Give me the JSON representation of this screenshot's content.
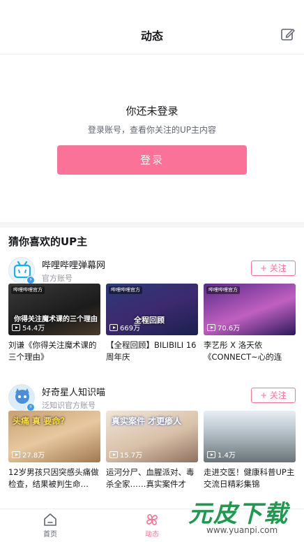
{
  "header": {
    "title": "动态",
    "edit_icon": "edit-icon"
  },
  "login": {
    "title": "你还未登录",
    "subtitle": "登录账号，查看你关注的UP主内容",
    "button_label": "登录"
  },
  "recommend": {
    "section_title": "猜你喜欢的UP主",
    "follow_label": "+ 关注",
    "ups": [
      {
        "name": "哔哩哔哩弹幕网",
        "desc": "官方账号",
        "videos": [
          {
            "views": "54.4万",
            "title": "刘谦《你得关注魔术课的三个理由》",
            "overlay": "你得关注魔术课的三个理由",
            "badge": "哔哩哔哩官方"
          },
          {
            "views": "669万",
            "title": "【全程回顾】BILIBILI 16周年庆",
            "overlay": "全程回顾",
            "badge": "哔哩哔哩官方"
          },
          {
            "views": "70.6万",
            "title": "李艺彤 X 洛天依《CONNECT~心的连接…",
            "overlay": "",
            "badge": "哔哩哔哩官方"
          }
        ]
      },
      {
        "name": "好奇星人知识喵",
        "desc": "泛知识官方账号",
        "videos": [
          {
            "views": "27.8万",
            "title": "12岁男孩只因突感头痛做检查，结果被判生命…",
            "overlay": "头痛 真 要命？",
            "badge": ""
          },
          {
            "views": "15.7万",
            "title": "运河分尸、血腥派对、毒杀全家……真实案件才更…",
            "overlay": "真实案件 才更瘆人",
            "badge": ""
          },
          {
            "views": "1.4万",
            "title": "走进交医！健康科普UP主交流日精彩集锦",
            "overlay": "",
            "badge": ""
          }
        ]
      }
    ]
  },
  "tabbar": {
    "home_label": "首页",
    "dynamic_label": "动态"
  },
  "watermark": {
    "main": "元皮下载",
    "url": "www.yuanpi.com"
  },
  "colors": {
    "accent": "#fb7299",
    "muted": "#9499a0",
    "watermark": "#1d9a4e"
  }
}
